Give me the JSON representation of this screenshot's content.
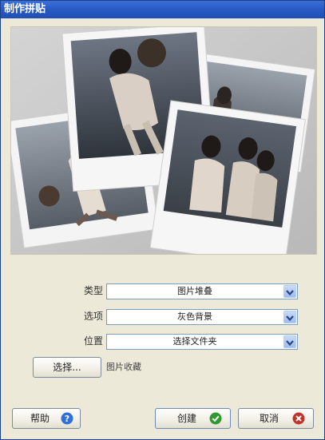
{
  "window": {
    "title": "制作拼贴"
  },
  "form": {
    "type_label": "类型",
    "type_value": "图片堆叠",
    "options_label": "选项",
    "options_value": "灰色背景",
    "location_label": "位置",
    "location_value": "选择文件夹",
    "select_button_label": "选择...",
    "collection_text": "图片收藏"
  },
  "footer": {
    "help_label": "帮助",
    "create_label": "创建",
    "cancel_label": "取消"
  },
  "icons": {
    "help": "question-icon",
    "create": "checkmark-icon",
    "cancel": "x-icon",
    "dropdown": "chevron-down-icon"
  },
  "colors": {
    "titlebar": "#2a5bc4",
    "help_icon": "#2f6fd8",
    "create_icon": "#2e9a2e",
    "cancel_icon": "#c0342d"
  }
}
